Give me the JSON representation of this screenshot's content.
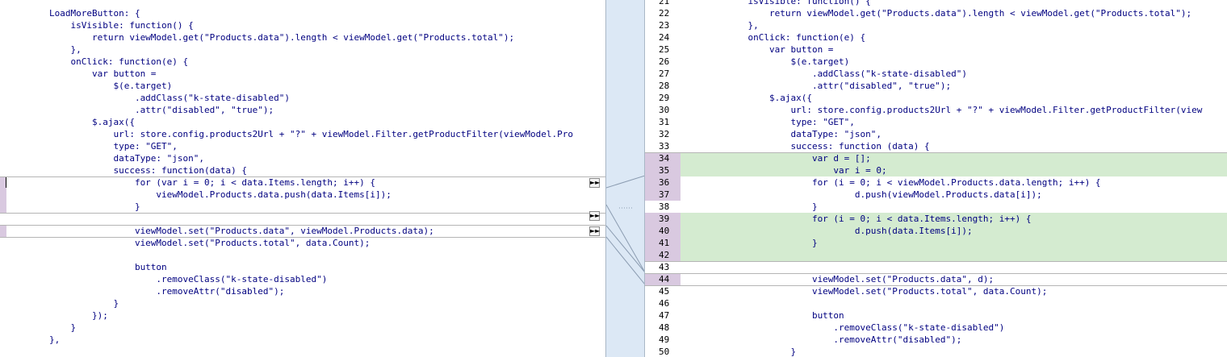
{
  "left": {
    "lines": [
      {
        "text": "        LoadMoreButton: {"
      },
      {
        "text": "            isVisible: function() {"
      },
      {
        "text": "                return viewModel.get(\"Products.data\").length < viewModel.get(\"Products.total\");"
      },
      {
        "text": "            },"
      },
      {
        "text": "            onClick: function(e) {"
      },
      {
        "text": "                var button ="
      },
      {
        "text": "                    $(e.target)"
      },
      {
        "text": "                        .addClass(\"k-state-disabled\")"
      },
      {
        "text": "                        .attr(\"disabled\", \"true\");"
      },
      {
        "text": "                $.ajax({"
      },
      {
        "text": "                    url: store.config.products2Url + \"?\" + viewModel.Filter.getProductFilter(viewModel.Pro"
      },
      {
        "text": "                    type: \"GET\","
      },
      {
        "text": "                    dataType: \"json\","
      },
      {
        "text": "                    success: function(data) {"
      },
      {
        "text": "                        for (var i = 0; i < data.Items.length; i++) {",
        "changed": true
      },
      {
        "text": "                            viewModel.Products.data.push(data.Items[i]);",
        "changed": true
      },
      {
        "text": "                        }",
        "changed": true
      },
      {
        "text": ""
      },
      {
        "text": "                        viewModel.set(\"Products.data\", viewModel.Products.data);",
        "changed": true
      },
      {
        "text": "                        viewModel.set(\"Products.total\", data.Count);"
      },
      {
        "text": ""
      },
      {
        "text": "                        button"
      },
      {
        "text": "                            .removeClass(\"k-state-disabled\")"
      },
      {
        "text": "                            .removeAttr(\"disabled\");"
      },
      {
        "text": "                    }"
      },
      {
        "text": "                });"
      },
      {
        "text": "            }"
      },
      {
        "text": "        },"
      }
    ],
    "copy_arrow": "►►"
  },
  "right": {
    "lines": [
      {
        "num": "21",
        "text": "            isVisible: function() {"
      },
      {
        "num": "22",
        "text": "                return viewModel.get(\"Products.data\").length < viewModel.get(\"Products.total\");"
      },
      {
        "num": "23",
        "text": "            },"
      },
      {
        "num": "24",
        "text": "            onClick: function(e) {"
      },
      {
        "num": "25",
        "text": "                var button ="
      },
      {
        "num": "26",
        "text": "                    $(e.target)"
      },
      {
        "num": "27",
        "text": "                        .addClass(\"k-state-disabled\")"
      },
      {
        "num": "28",
        "text": "                        .attr(\"disabled\", \"true\");"
      },
      {
        "num": "29",
        "text": "                $.ajax({"
      },
      {
        "num": "30",
        "text": "                    url: store.config.products2Url + \"?\" + viewModel.Filter.getProductFilter(view"
      },
      {
        "num": "31",
        "text": "                    type: \"GET\","
      },
      {
        "num": "32",
        "text": "                    dataType: \"json\","
      },
      {
        "num": "33",
        "text": "                    success: function (data) {"
      },
      {
        "num": "34",
        "text": "                        var d = [];",
        "state": "added"
      },
      {
        "num": "35",
        "text": "                            var i = 0;",
        "state": "added"
      },
      {
        "num": "36",
        "text": "                        for (i = 0; i < viewModel.Products.data.length; i++) {",
        "state": "changed"
      },
      {
        "num": "37",
        "text": "                                d.push(viewModel.Products.data[i]);",
        "state": "changed"
      },
      {
        "num": "38",
        "text": "                        }"
      },
      {
        "num": "39",
        "text": "                        for (i = 0; i < data.Items.length; i++) {",
        "state": "added"
      },
      {
        "num": "40",
        "text": "                                d.push(data.Items[i]);",
        "state": "added"
      },
      {
        "num": "41",
        "text": "                        }",
        "state": "added"
      },
      {
        "num": "42",
        "text": "",
        "state": "added"
      },
      {
        "num": "43",
        "text": ""
      },
      {
        "num": "44",
        "text": "                        viewModel.set(\"Products.data\", d);",
        "state": "changed"
      },
      {
        "num": "45",
        "text": "                        viewModel.set(\"Products.total\", data.Count);"
      },
      {
        "num": "46",
        "text": ""
      },
      {
        "num": "47",
        "text": "                        button"
      },
      {
        "num": "48",
        "text": "                            .removeClass(\"k-state-disabled\")"
      },
      {
        "num": "49",
        "text": "                            .removeAttr(\"disabled\");"
      },
      {
        "num": "50",
        "text": "                    }"
      }
    ]
  },
  "colors": {
    "added": "#d4ebd0",
    "changed_marker": "#d9c9e0",
    "gutter": "#dce8f5"
  }
}
